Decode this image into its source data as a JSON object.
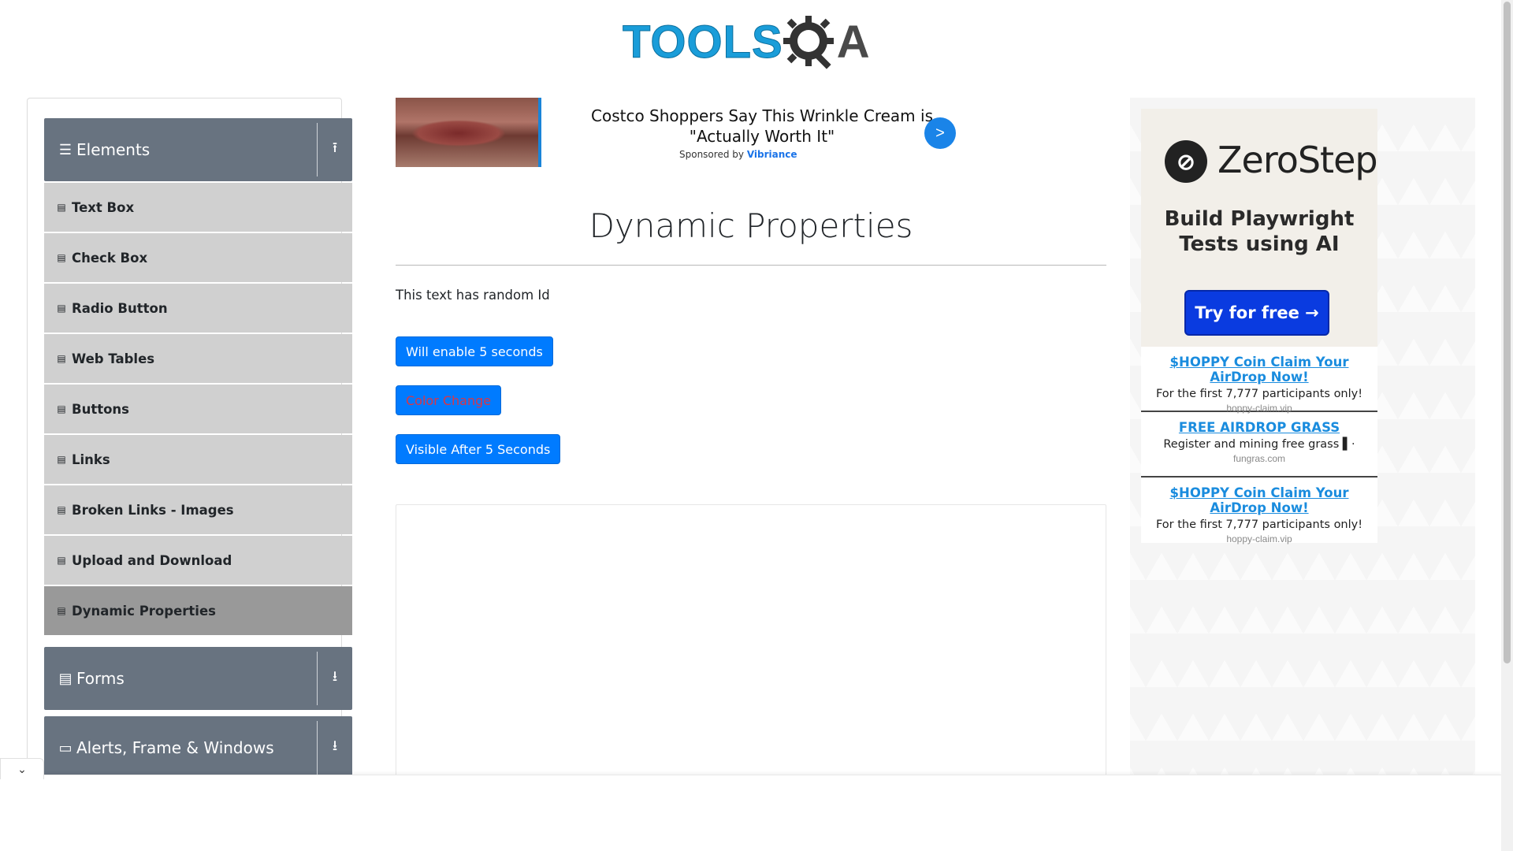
{
  "header": {
    "logo_part1": "TOOLS",
    "logo_part2": "A"
  },
  "sidebar": {
    "groups": [
      {
        "title": "Elements",
        "icon": "hamburger-icon",
        "toggle": "collapse-icon",
        "items": [
          {
            "label": "Text Box"
          },
          {
            "label": "Check Box"
          },
          {
            "label": "Radio Button"
          },
          {
            "label": "Web Tables"
          },
          {
            "label": "Buttons"
          },
          {
            "label": "Links"
          },
          {
            "label": "Broken Links - Images"
          },
          {
            "label": "Upload and Download"
          },
          {
            "label": "Dynamic Properties",
            "active": true
          }
        ]
      },
      {
        "title": "Forms",
        "icon": "document-icon",
        "toggle": "expand-icon"
      },
      {
        "title": "Alerts, Frame & Windows",
        "icon": "window-icon",
        "toggle": "expand-icon"
      }
    ]
  },
  "ad_banner": {
    "headline": "Costco Shoppers Say This Wrinkle Cream is \"Actually Worth It\"",
    "sponsored_by": "Sponsored by",
    "sponsor": "Vibriance",
    "go_label": ">"
  },
  "main": {
    "title": "Dynamic Properties",
    "random_text": "This text has random Id",
    "enable_button": "Will enable 5 seconds",
    "color_button": "Color Change",
    "visible_button": "Visible After 5 Seconds"
  },
  "right_ad": {
    "brand": "ZeroStep",
    "tagline": "Build Playwright Tests using AI",
    "cta": "Try for free →",
    "text_ads": [
      {
        "title": "$HOPPY Coin Claim Your AirDrop Now!",
        "desc": "For the first 7,777 participants only!",
        "url": "hoppy-claim.vip"
      },
      {
        "title": "FREE AIRDROP GRASS",
        "desc": "Register and mining free grass ▌·",
        "url": "fungras.com"
      },
      {
        "title": "$HOPPY Coin Claim Your AirDrop Now!",
        "desc": "For the first 7,777 participants only!",
        "url": "hoppy-claim.vip"
      }
    ]
  },
  "colors": {
    "accent": "#007bff",
    "sidebar_header": "#687380",
    "menu_item": "#d0d0d0",
    "menu_active": "#999999",
    "color_change_text": "#dc3545"
  }
}
